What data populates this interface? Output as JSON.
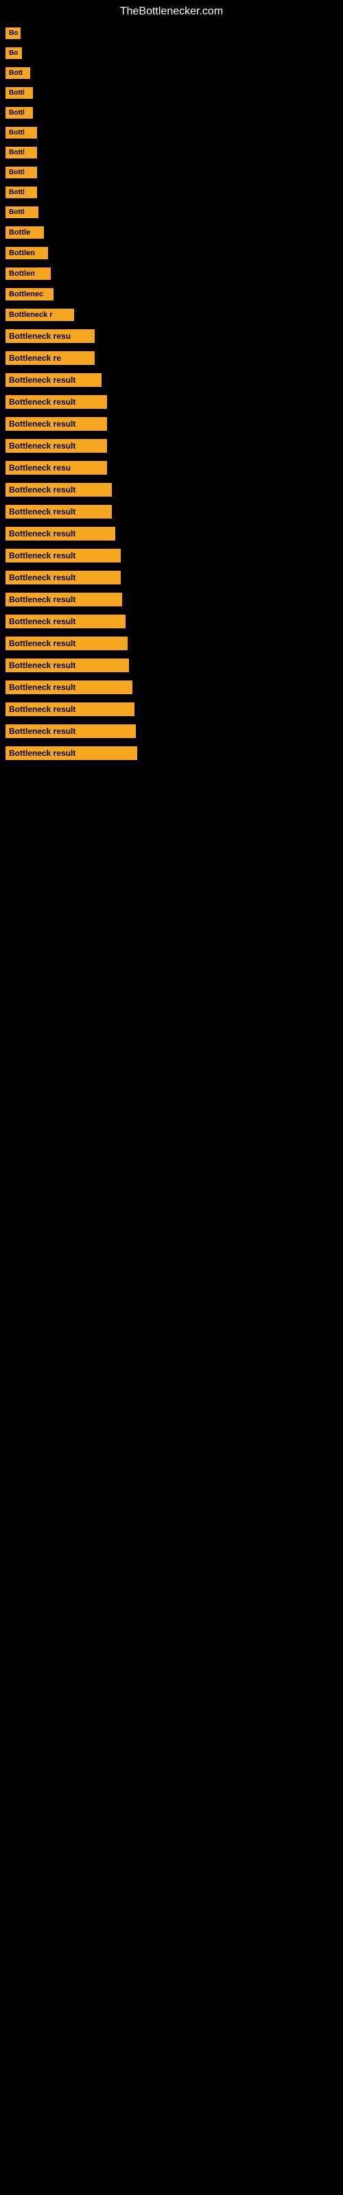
{
  "site": {
    "title": "TheBottlenecker.com"
  },
  "items": [
    {
      "id": 1,
      "label": "Bo"
    },
    {
      "id": 2,
      "label": "Bo"
    },
    {
      "id": 3,
      "label": "Bott"
    },
    {
      "id": 4,
      "label": "Bottl"
    },
    {
      "id": 5,
      "label": "Bottl"
    },
    {
      "id": 6,
      "label": "Bottl"
    },
    {
      "id": 7,
      "label": "Bottl"
    },
    {
      "id": 8,
      "label": "Bottl"
    },
    {
      "id": 9,
      "label": "Bottl"
    },
    {
      "id": 10,
      "label": "Bottl"
    },
    {
      "id": 11,
      "label": "Bottle"
    },
    {
      "id": 12,
      "label": "Bottlen"
    },
    {
      "id": 13,
      "label": "Bottlen"
    },
    {
      "id": 14,
      "label": "Bottlenec"
    },
    {
      "id": 15,
      "label": "Bottleneck r"
    },
    {
      "id": 16,
      "label": "Bottleneck resu"
    },
    {
      "id": 17,
      "label": "Bottleneck re"
    },
    {
      "id": 18,
      "label": "Bottleneck result"
    },
    {
      "id": 19,
      "label": "Bottleneck result"
    },
    {
      "id": 20,
      "label": "Bottleneck result"
    },
    {
      "id": 21,
      "label": "Bottleneck result"
    },
    {
      "id": 22,
      "label": "Bottleneck resu"
    },
    {
      "id": 23,
      "label": "Bottleneck result"
    },
    {
      "id": 24,
      "label": "Bottleneck result"
    },
    {
      "id": 25,
      "label": "Bottleneck result"
    },
    {
      "id": 26,
      "label": "Bottleneck result"
    },
    {
      "id": 27,
      "label": "Bottleneck result"
    },
    {
      "id": 28,
      "label": "Bottleneck result"
    },
    {
      "id": 29,
      "label": "Bottleneck result"
    },
    {
      "id": 30,
      "label": "Bottleneck result"
    },
    {
      "id": 31,
      "label": "Bottleneck result"
    },
    {
      "id": 32,
      "label": "Bottleneck result"
    },
    {
      "id": 33,
      "label": "Bottleneck result"
    },
    {
      "id": 34,
      "label": "Bottleneck result"
    },
    {
      "id": 35,
      "label": "Bottleneck result"
    }
  ],
  "colors": {
    "background": "#000000",
    "label_bg": "#f5a623",
    "text": "#ffffff"
  }
}
